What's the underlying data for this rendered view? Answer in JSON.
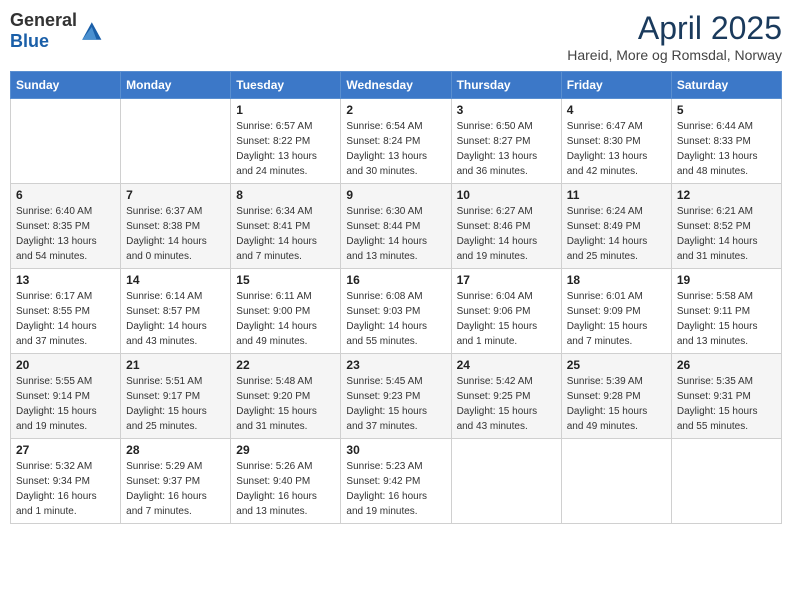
{
  "header": {
    "logo_general": "General",
    "logo_blue": "Blue",
    "month": "April 2025",
    "location": "Hareid, More og Romsdal, Norway"
  },
  "days_of_week": [
    "Sunday",
    "Monday",
    "Tuesday",
    "Wednesday",
    "Thursday",
    "Friday",
    "Saturday"
  ],
  "weeks": [
    [
      {
        "day": "",
        "info": ""
      },
      {
        "day": "",
        "info": ""
      },
      {
        "day": "1",
        "info": "Sunrise: 6:57 AM\nSunset: 8:22 PM\nDaylight: 13 hours and 24 minutes."
      },
      {
        "day": "2",
        "info": "Sunrise: 6:54 AM\nSunset: 8:24 PM\nDaylight: 13 hours and 30 minutes."
      },
      {
        "day": "3",
        "info": "Sunrise: 6:50 AM\nSunset: 8:27 PM\nDaylight: 13 hours and 36 minutes."
      },
      {
        "day": "4",
        "info": "Sunrise: 6:47 AM\nSunset: 8:30 PM\nDaylight: 13 hours and 42 minutes."
      },
      {
        "day": "5",
        "info": "Sunrise: 6:44 AM\nSunset: 8:33 PM\nDaylight: 13 hours and 48 minutes."
      }
    ],
    [
      {
        "day": "6",
        "info": "Sunrise: 6:40 AM\nSunset: 8:35 PM\nDaylight: 13 hours and 54 minutes."
      },
      {
        "day": "7",
        "info": "Sunrise: 6:37 AM\nSunset: 8:38 PM\nDaylight: 14 hours and 0 minutes."
      },
      {
        "day": "8",
        "info": "Sunrise: 6:34 AM\nSunset: 8:41 PM\nDaylight: 14 hours and 7 minutes."
      },
      {
        "day": "9",
        "info": "Sunrise: 6:30 AM\nSunset: 8:44 PM\nDaylight: 14 hours and 13 minutes."
      },
      {
        "day": "10",
        "info": "Sunrise: 6:27 AM\nSunset: 8:46 PM\nDaylight: 14 hours and 19 minutes."
      },
      {
        "day": "11",
        "info": "Sunrise: 6:24 AM\nSunset: 8:49 PM\nDaylight: 14 hours and 25 minutes."
      },
      {
        "day": "12",
        "info": "Sunrise: 6:21 AM\nSunset: 8:52 PM\nDaylight: 14 hours and 31 minutes."
      }
    ],
    [
      {
        "day": "13",
        "info": "Sunrise: 6:17 AM\nSunset: 8:55 PM\nDaylight: 14 hours and 37 minutes."
      },
      {
        "day": "14",
        "info": "Sunrise: 6:14 AM\nSunset: 8:57 PM\nDaylight: 14 hours and 43 minutes."
      },
      {
        "day": "15",
        "info": "Sunrise: 6:11 AM\nSunset: 9:00 PM\nDaylight: 14 hours and 49 minutes."
      },
      {
        "day": "16",
        "info": "Sunrise: 6:08 AM\nSunset: 9:03 PM\nDaylight: 14 hours and 55 minutes."
      },
      {
        "day": "17",
        "info": "Sunrise: 6:04 AM\nSunset: 9:06 PM\nDaylight: 15 hours and 1 minute."
      },
      {
        "day": "18",
        "info": "Sunrise: 6:01 AM\nSunset: 9:09 PM\nDaylight: 15 hours and 7 minutes."
      },
      {
        "day": "19",
        "info": "Sunrise: 5:58 AM\nSunset: 9:11 PM\nDaylight: 15 hours and 13 minutes."
      }
    ],
    [
      {
        "day": "20",
        "info": "Sunrise: 5:55 AM\nSunset: 9:14 PM\nDaylight: 15 hours and 19 minutes."
      },
      {
        "day": "21",
        "info": "Sunrise: 5:51 AM\nSunset: 9:17 PM\nDaylight: 15 hours and 25 minutes."
      },
      {
        "day": "22",
        "info": "Sunrise: 5:48 AM\nSunset: 9:20 PM\nDaylight: 15 hours and 31 minutes."
      },
      {
        "day": "23",
        "info": "Sunrise: 5:45 AM\nSunset: 9:23 PM\nDaylight: 15 hours and 37 minutes."
      },
      {
        "day": "24",
        "info": "Sunrise: 5:42 AM\nSunset: 9:25 PM\nDaylight: 15 hours and 43 minutes."
      },
      {
        "day": "25",
        "info": "Sunrise: 5:39 AM\nSunset: 9:28 PM\nDaylight: 15 hours and 49 minutes."
      },
      {
        "day": "26",
        "info": "Sunrise: 5:35 AM\nSunset: 9:31 PM\nDaylight: 15 hours and 55 minutes."
      }
    ],
    [
      {
        "day": "27",
        "info": "Sunrise: 5:32 AM\nSunset: 9:34 PM\nDaylight: 16 hours and 1 minute."
      },
      {
        "day": "28",
        "info": "Sunrise: 5:29 AM\nSunset: 9:37 PM\nDaylight: 16 hours and 7 minutes."
      },
      {
        "day": "29",
        "info": "Sunrise: 5:26 AM\nSunset: 9:40 PM\nDaylight: 16 hours and 13 minutes."
      },
      {
        "day": "30",
        "info": "Sunrise: 5:23 AM\nSunset: 9:42 PM\nDaylight: 16 hours and 19 minutes."
      },
      {
        "day": "",
        "info": ""
      },
      {
        "day": "",
        "info": ""
      },
      {
        "day": "",
        "info": ""
      }
    ]
  ]
}
